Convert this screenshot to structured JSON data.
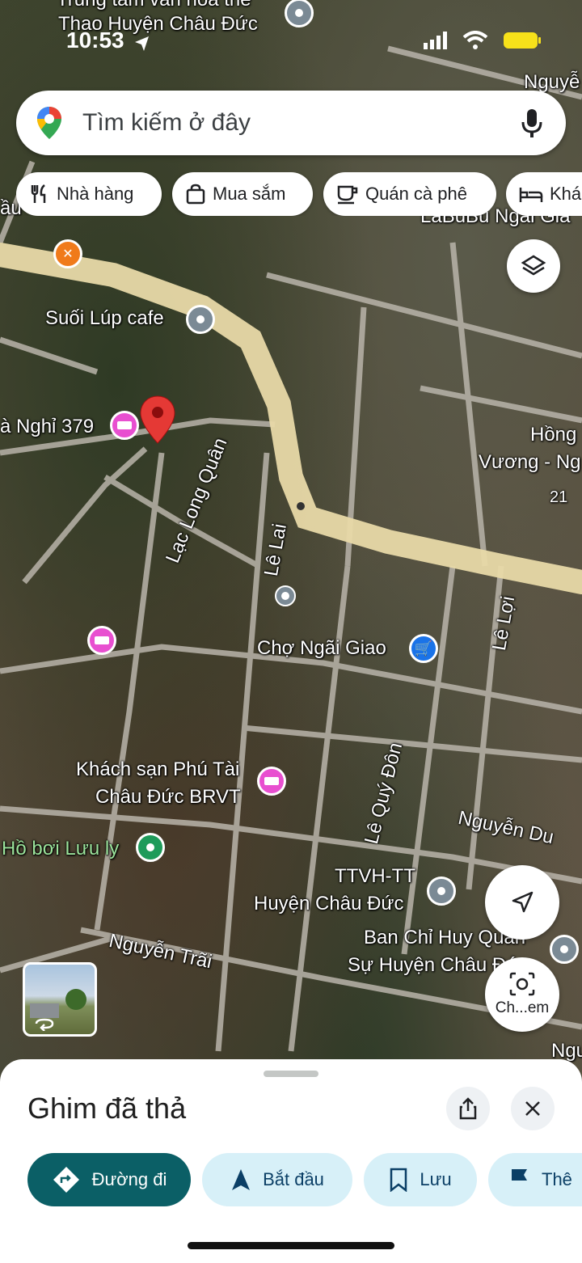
{
  "status": {
    "time": "10:53"
  },
  "search": {
    "placeholder": "Tìm kiếm ở đây"
  },
  "chips": [
    {
      "label": "Nhà hàng",
      "icon": "restaurant-icon"
    },
    {
      "label": "Mua sắm",
      "icon": "shopping-bag-icon"
    },
    {
      "label": "Quán cà phê",
      "icon": "coffee-icon"
    },
    {
      "label": "Khá",
      "icon": "hotel-icon"
    }
  ],
  "map": {
    "labels": {
      "top_center_line1": "Trung tâm văn hóa thể",
      "top_center_line2": "Thao Huyện Châu Đức",
      "nguye_top": "Nguyễ",
      "au": "ầu",
      "labubu": "LaBuBu Ngãi Gia",
      "suoi_lup": "Suối Lúp cafe",
      "nha_nghi": "à Nghỉ 379",
      "hong_line1": "Hồng",
      "hong_line2": "Vương - Ng",
      "num_21": "21",
      "lac_long_quan": "Lạc Long Quân",
      "le_lai": "Lê Lai",
      "le_loi": "Lê Lợi",
      "cho_ngai_giao": "Chợ Ngãi Giao",
      "le_quy_don": "Lê Quý Đôn",
      "nguyen_du": "Nguyễn Du",
      "ks_line1": "Khách sạn Phú Tài",
      "ks_line2": "Châu Đức BRVT",
      "ho_boi": "Hồ bơi Lưu ly",
      "ttvh_line1": "TTVH-TT",
      "ttvh_line2": "Huyện Châu Đức",
      "ban_chi_line1": "Ban Chỉ Huy Quân",
      "ban_chi_line2": "Sự Huyện Châu Đức",
      "nguyen_trai": "Nguyễn Trãi",
      "ngu_bottom": "Ngu"
    },
    "camera_label": "Ch...em"
  },
  "sheet": {
    "title": "Ghim đã thả",
    "actions": [
      {
        "label": "Đường đi"
      },
      {
        "label": "Bắt đầu"
      },
      {
        "label": "Lưu"
      },
      {
        "label": "Thê"
      }
    ]
  },
  "colors": {
    "primary": "#0b5f66",
    "secondary": "#d7f0f8",
    "pin_red": "#e53935",
    "road_main": "#e8d9a8"
  }
}
